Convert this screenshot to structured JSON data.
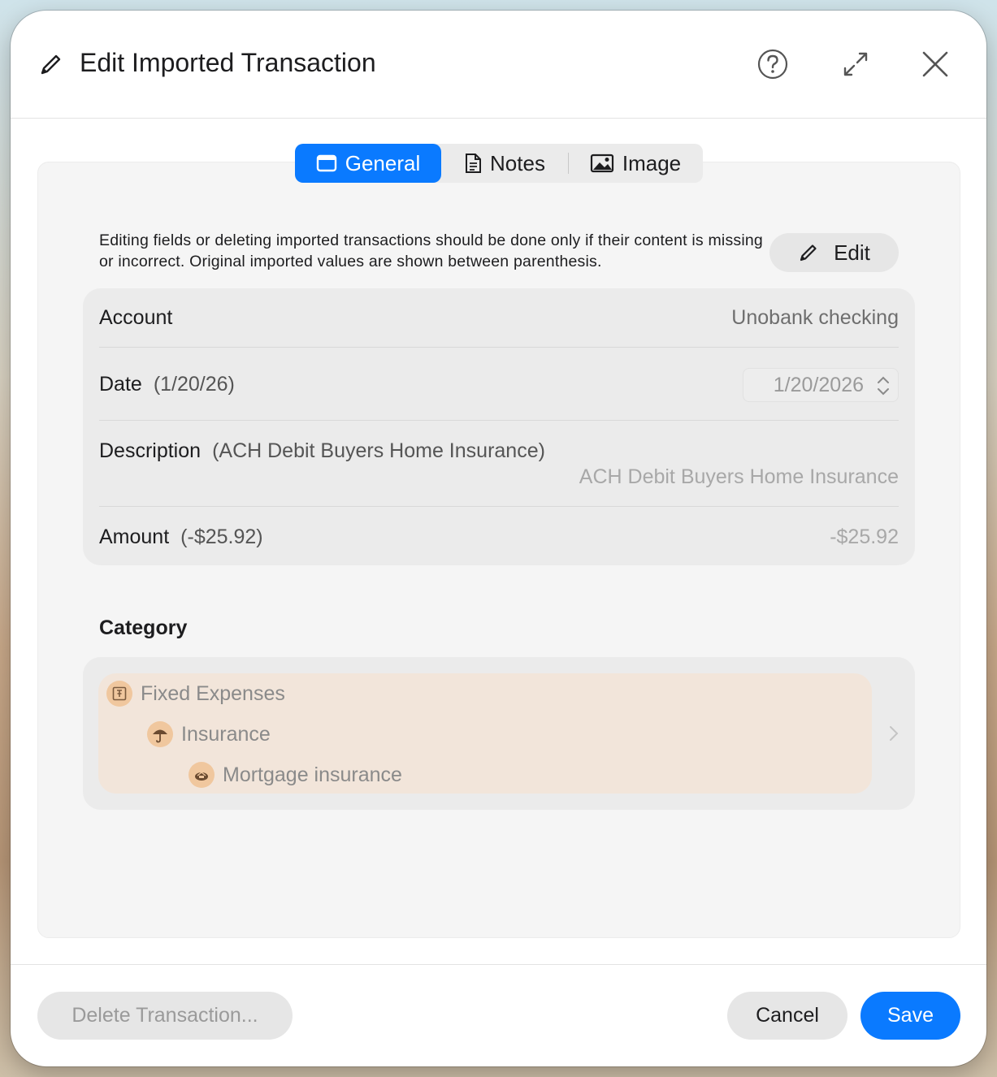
{
  "dialog": {
    "title": "Edit Imported Transaction",
    "icons": {
      "title": "pencil-icon",
      "help": "question-circle-icon",
      "expand": "expand-arrows-icon",
      "close": "close-icon"
    }
  },
  "tabs": [
    {
      "label": "General",
      "icon": "window-icon",
      "selected": true
    },
    {
      "label": "Notes",
      "icon": "document-icon",
      "selected": false
    },
    {
      "label": "Image",
      "icon": "photo-icon",
      "selected": false
    }
  ],
  "notice": {
    "text": "Editing fields or deleting imported transactions should be done only if their content is missing or incorrect. Original imported values are shown between parenthesis.",
    "edit_label": "Edit"
  },
  "fields": {
    "account": {
      "label": "Account",
      "value": "Unobank checking"
    },
    "date": {
      "label": "Date",
      "original": "(1/20/26)",
      "value": "1/20/2026"
    },
    "description": {
      "label": "Description",
      "original": "(ACH Debit Buyers Home Insurance)",
      "value": "ACH Debit Buyers Home Insurance"
    },
    "amount": {
      "label": "Amount",
      "original": "(-$25.92)",
      "value": "-$25.92"
    }
  },
  "category": {
    "heading": "Category",
    "path": [
      {
        "label": "Fixed Expenses",
        "icon": "pin-icon"
      },
      {
        "label": "Insurance",
        "icon": "umbrella-icon"
      },
      {
        "label": "Mortgage insurance",
        "icon": "house-coin-icon"
      }
    ]
  },
  "footer": {
    "delete_label": "Delete Transaction...",
    "cancel_label": "Cancel",
    "save_label": "Save"
  },
  "colors": {
    "accent": "#0a7aff",
    "category_bg": "#f2e5da",
    "category_icon": "#f0c79e"
  }
}
